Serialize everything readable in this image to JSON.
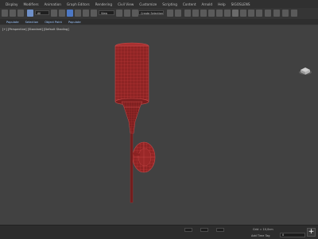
{
  "menu": [
    "Display",
    "Modifiers",
    "Animation",
    "Graph Editors",
    "Rendering",
    "Civil View",
    "Customize",
    "Scripting",
    "Content",
    "Arnold",
    "Help",
    "SIGOSLENS"
  ],
  "toolbar": {
    "filter_dropdown": "All",
    "view_dropdown": "View",
    "selection_set_dropdown": "Create Selection Se"
  },
  "ribbon": [
    "Populate",
    "Selection",
    "Object Paint",
    "Populate"
  ],
  "viewport": {
    "label": "[+] [Perspective] [Standard] [Default Shading]",
    "viewcube_button": "+"
  },
  "statusbar": {
    "grid_text": "Grid = 10,0cm",
    "add_time_tag": "Add Time Tag",
    "frame_value": "0"
  },
  "colors": {
    "wire": "#b32a2a",
    "fill": "#8e2424",
    "viewport_bg": "#414141"
  }
}
